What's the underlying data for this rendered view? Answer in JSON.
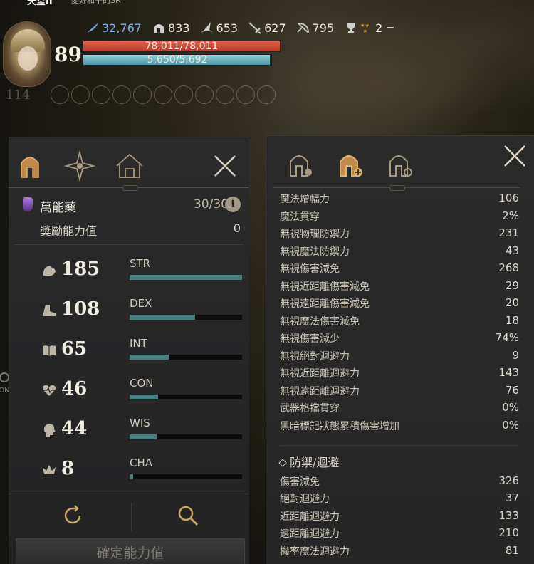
{
  "header": {
    "character_name": "天堂II",
    "subtitle": "愛好和平的SR",
    "level": "89",
    "stats": [
      {
        "icon": "feather-icon",
        "value": "32,767",
        "blue": true
      },
      {
        "icon": "helmet-icon",
        "value": "833"
      },
      {
        "icon": "wizard-hat-icon",
        "value": "653"
      },
      {
        "icon": "sword-icon",
        "value": "627"
      },
      {
        "icon": "bow-icon",
        "value": "795"
      },
      {
        "icon": "trophy-icon",
        "value": "2"
      }
    ],
    "hp_text": "78,011/78,011",
    "hp_fraction": 1.0,
    "mp_text": "5,650/5,692",
    "mp_fraction": 0.9926,
    "buff_level": "114"
  },
  "left_panel": {
    "tabs": [
      "helmet-tab-icon",
      "star-compass-tab-icon",
      "house-tab-icon"
    ],
    "elixir_label": "萬能藥",
    "elixir_count": "30/30",
    "info_symbol": "i",
    "bonus_label": "獎勵能力值",
    "bonus_value": "0",
    "attributes": [
      {
        "icon": "arm-strength-icon",
        "value": "185",
        "code": "STR",
        "fill": 1.0
      },
      {
        "icon": "boot-dex-icon",
        "value": "108",
        "code": "DEX",
        "fill": 0.58
      },
      {
        "icon": "book-int-icon",
        "value": "65",
        "code": "INT",
        "fill": 0.35
      },
      {
        "icon": "heart-con-icon",
        "value": "46",
        "code": "CON",
        "fill": 0.25
      },
      {
        "icon": "head-wis-icon",
        "value": "44",
        "code": "WIS",
        "fill": 0.24
      },
      {
        "icon": "crown-cha-icon",
        "value": "8",
        "code": "CHA",
        "fill": 0.03
      }
    ],
    "on_label": "ON",
    "confirm_label": "確定能力值"
  },
  "right_panel": {
    "rows": [
      {
        "label": "魔法增幅力",
        "value": "106"
      },
      {
        "label": "魔法貫穿",
        "value": "2%"
      },
      {
        "label": "無視物理防禦力",
        "value": "231"
      },
      {
        "label": "無視魔法防禦力",
        "value": "43"
      },
      {
        "label": "無視傷害減免",
        "value": "268"
      },
      {
        "label": "無視近距離傷害減免",
        "value": "29"
      },
      {
        "label": "無視遠距離傷害減免",
        "value": "20"
      },
      {
        "label": "無視魔法傷害減免",
        "value": "18"
      },
      {
        "label": "無視傷害減少",
        "value": "74%"
      },
      {
        "label": "無視絕對迴避力",
        "value": "9"
      },
      {
        "label": "無視近距離迴避力",
        "value": "143"
      },
      {
        "label": "無視遠距離迴避力",
        "value": "76"
      },
      {
        "label": "武器格擋貫穿",
        "value": "0%"
      },
      {
        "label": "黑暗標記狀態累積傷害增加",
        "value": "0%"
      }
    ],
    "section_title": "防禦/迴避",
    "defense_rows": [
      {
        "label": "傷害減免",
        "value": "326"
      },
      {
        "label": "絕對迴避力",
        "value": "37"
      },
      {
        "label": "近距離迴避力",
        "value": "133"
      },
      {
        "label": "遠距離迴避力",
        "value": "210"
      },
      {
        "label": "機率魔法迴避力",
        "value": "81"
      }
    ]
  }
}
